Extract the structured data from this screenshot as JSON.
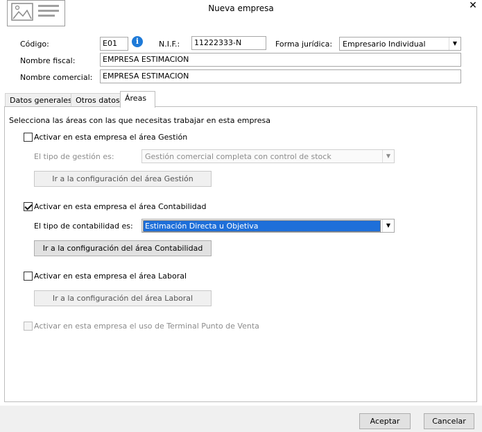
{
  "window": {
    "title": "Nueva empresa",
    "close_glyph": "✕"
  },
  "header": {
    "codigo_label": "Código:",
    "codigo_value": "E01",
    "nif_label": "N.I.F.:",
    "nif_value": "11222333-N",
    "forma_label": "Forma jurídica:",
    "forma_value": "Empresario Individual",
    "nombre_fiscal_label": "Nombre fiscal:",
    "nombre_fiscal_value": "EMPRESA ESTIMACION",
    "nombre_comercial_label": "Nombre comercial:",
    "nombre_comercial_value": "EMPRESA ESTIMACION"
  },
  "tabs": [
    {
      "label": "Datos generales"
    },
    {
      "label": "Otros datos"
    },
    {
      "label": "Áreas"
    }
  ],
  "areas": {
    "intro": "Selecciona las áreas con las que necesitas trabajar en esta empresa",
    "gestion": {
      "checkbox_label": "Activar en esta empresa el área Gestión",
      "checked": false,
      "tipo_label": "El tipo de gestión es:",
      "tipo_value": "Gestión comercial completa con control de stock",
      "button": "Ir a la configuración del área Gestión"
    },
    "contabilidad": {
      "checkbox_label": "Activar en esta empresa el área Contabilidad",
      "checked": true,
      "tipo_label": "El tipo de contabilidad es:",
      "tipo_value": "Estimación Directa u Objetiva",
      "button": "Ir a la configuración del área Contabilidad"
    },
    "laboral": {
      "checkbox_label": "Activar en esta empresa el área Laboral",
      "checked": false,
      "button": "Ir a la configuración del área Laboral"
    },
    "tpv": {
      "checkbox_label": "Activar en esta empresa el uso de Terminal Punto de Venta",
      "checked": false
    }
  },
  "footer": {
    "accept": "Aceptar",
    "cancel": "Cancelar"
  },
  "colors": {
    "accent": "#1e6fd9",
    "info_icon": "#1e7ad8"
  }
}
